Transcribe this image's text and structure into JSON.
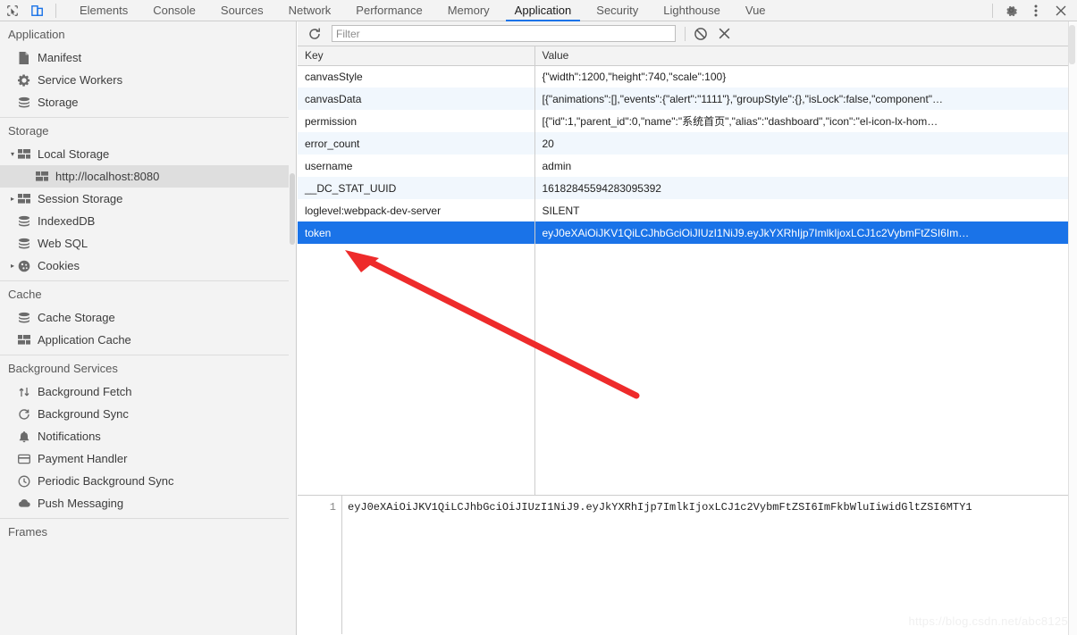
{
  "toolbar": {
    "inspect_icon": "inspect-cursor-icon",
    "device_icon": "device-toolbar-icon",
    "tabs": [
      {
        "label": "Elements",
        "active": false
      },
      {
        "label": "Console",
        "active": false
      },
      {
        "label": "Sources",
        "active": false
      },
      {
        "label": "Network",
        "active": false
      },
      {
        "label": "Performance",
        "active": false
      },
      {
        "label": "Memory",
        "active": false
      },
      {
        "label": "Application",
        "active": true
      },
      {
        "label": "Security",
        "active": false
      },
      {
        "label": "Lighthouse",
        "active": false
      },
      {
        "label": "Vue",
        "active": false
      }
    ],
    "settings_icon": "gear-icon",
    "more_icon": "kebab-menu-icon",
    "close_icon": "close-icon",
    "accent_color": "#1a73e8"
  },
  "sidebar": {
    "sections": [
      {
        "title": "Application",
        "items": [
          {
            "label": "Manifest",
            "icon": "document-icon",
            "arrow": "",
            "selected": false
          },
          {
            "label": "Service Workers",
            "icon": "gear-icon",
            "arrow": "",
            "selected": false
          },
          {
            "label": "Storage",
            "icon": "database-icon",
            "arrow": "",
            "selected": false
          }
        ]
      },
      {
        "title": "Storage",
        "items": [
          {
            "label": "Local Storage",
            "icon": "table-icon",
            "arrow": "▾",
            "selected": false
          },
          {
            "label": "http://localhost:8080",
            "icon": "table-icon",
            "arrow": "",
            "selected": true,
            "child": true
          },
          {
            "label": "Session Storage",
            "icon": "table-icon",
            "arrow": "▸",
            "selected": false
          },
          {
            "label": "IndexedDB",
            "icon": "database-icon",
            "arrow": "",
            "selected": false
          },
          {
            "label": "Web SQL",
            "icon": "database-icon",
            "arrow": "",
            "selected": false
          },
          {
            "label": "Cookies",
            "icon": "cookie-icon",
            "arrow": "▸",
            "selected": false
          }
        ]
      },
      {
        "title": "Cache",
        "items": [
          {
            "label": "Cache Storage",
            "icon": "database-icon",
            "arrow": "",
            "selected": false
          },
          {
            "label": "Application Cache",
            "icon": "table-icon",
            "arrow": "",
            "selected": false
          }
        ]
      },
      {
        "title": "Background Services",
        "items": [
          {
            "label": "Background Fetch",
            "icon": "updown-arrows-icon",
            "arrow": "",
            "selected": false
          },
          {
            "label": "Background Sync",
            "icon": "sync-icon",
            "arrow": "",
            "selected": false
          },
          {
            "label": "Notifications",
            "icon": "bell-icon",
            "arrow": "",
            "selected": false
          },
          {
            "label": "Payment Handler",
            "icon": "credit-card-icon",
            "arrow": "",
            "selected": false
          },
          {
            "label": "Periodic Background Sync",
            "icon": "clock-icon",
            "arrow": "",
            "selected": false
          },
          {
            "label": "Push Messaging",
            "icon": "cloud-icon",
            "arrow": "",
            "selected": false
          }
        ]
      },
      {
        "title": "Frames",
        "items": []
      }
    ]
  },
  "filterbar": {
    "refresh_icon": "refresh-icon",
    "filter_placeholder": "Filter",
    "filter_value": "",
    "clear_all_icon": "clear-all-icon",
    "delete_icon": "delete-selected-icon"
  },
  "table": {
    "columns": [
      "Key",
      "Value"
    ],
    "rows": [
      {
        "key": "canvasStyle",
        "value": "{\"width\":1200,\"height\":740,\"scale\":100}",
        "selected": false
      },
      {
        "key": "canvasData",
        "value": "[{\"animations\":[],\"events\":{\"alert\":\"1111\"},\"groupStyle\":{},\"isLock\":false,\"component\"…",
        "selected": false
      },
      {
        "key": "permission",
        "value": "[{\"id\":1,\"parent_id\":0,\"name\":\"系统首页\",\"alias\":\"dashboard\",\"icon\":\"el-icon-lx-hom…",
        "selected": false
      },
      {
        "key": "error_count",
        "value": "20",
        "selected": false
      },
      {
        "key": "username",
        "value": "admin",
        "selected": false
      },
      {
        "key": "__DC_STAT_UUID",
        "value": "16182845594283095392",
        "selected": false
      },
      {
        "key": "loglevel:webpack-dev-server",
        "value": "SILENT",
        "selected": false
      },
      {
        "key": "token",
        "value": "eyJ0eXAiOiJKV1QiLCJhbGciOiJIUzI1NiJ9.eyJkYXRhIjp7ImlkIjoxLCJ1c2VybmFtZSI6Im…",
        "selected": true
      }
    ]
  },
  "preview": {
    "line_number": "1",
    "content": "eyJ0eXAiOiJKV1QiLCJhbGciOiJIUzI1NiJ9.eyJkYXRhIjp7ImlkIjoxLCJ1c2VybmFtZSI6ImFkbWluIiwidGltZSI6MTY1"
  },
  "annotation": {
    "arrow_color": "#ee2b2b",
    "description": "red-arrow-pointing-to-token-row"
  },
  "watermark": {
    "text": "https://blog.csdn.net/abc8125"
  }
}
